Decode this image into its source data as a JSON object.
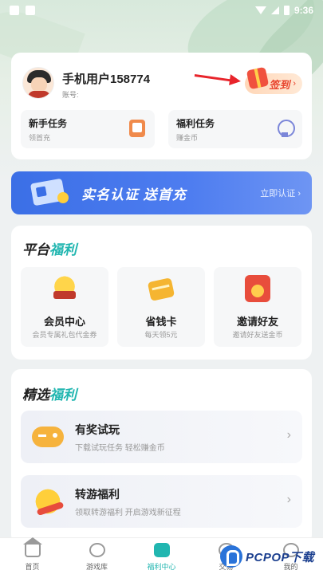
{
  "status_bar": {
    "time": "9:36"
  },
  "profile": {
    "username": "手机用户158774",
    "account_label": "账号:",
    "signin_label": "签到",
    "signin_chevron": "›"
  },
  "tasks": [
    {
      "title": "新手任务",
      "subtitle": "领首充",
      "icon": "phone-task-icon"
    },
    {
      "title": "福利任务",
      "subtitle": "赚金币",
      "icon": "badge-icon"
    }
  ],
  "banner": {
    "title": "实名认证  送首充",
    "cta": "立即认证 ›"
  },
  "platform_section": {
    "title_dark": "平台",
    "title_accent": "福利",
    "items": [
      {
        "title": "会员中心",
        "subtitle": "会员专属礼包代金券",
        "icon": "vip-crown-icon"
      },
      {
        "title": "省钱卡",
        "subtitle": "每天领5元",
        "icon": "money-card-icon"
      },
      {
        "title": "邀请好友",
        "subtitle": "邀请好友送金币",
        "icon": "red-envelope-icon"
      }
    ]
  },
  "selected_section": {
    "title_dark": "精选",
    "title_accent": "福利",
    "items": [
      {
        "title": "有奖试玩",
        "subtitle": "下载试玩任务 轻松赚金币",
        "icon": "gamepad-icon"
      },
      {
        "title": "转游福利",
        "subtitle": "领取转游福利 开启游戏新征程",
        "icon": "transfer-coin-icon"
      }
    ]
  },
  "bottom_nav": {
    "items": [
      {
        "label": "首页",
        "icon": "home-icon"
      },
      {
        "label": "游戏库",
        "icon": "games-icon"
      },
      {
        "label": "福利中心",
        "icon": "gift-icon",
        "active": true
      },
      {
        "label": "交易",
        "icon": "trade-icon"
      },
      {
        "label": "我的",
        "icon": "user-icon"
      }
    ]
  },
  "watermark": {
    "text": "PCPOP下载"
  },
  "colors": {
    "accent": "#21b6b0",
    "banner_blue": "#3b6fe6",
    "signin_red": "#e8442e",
    "arrow_red": "#e8242b"
  }
}
